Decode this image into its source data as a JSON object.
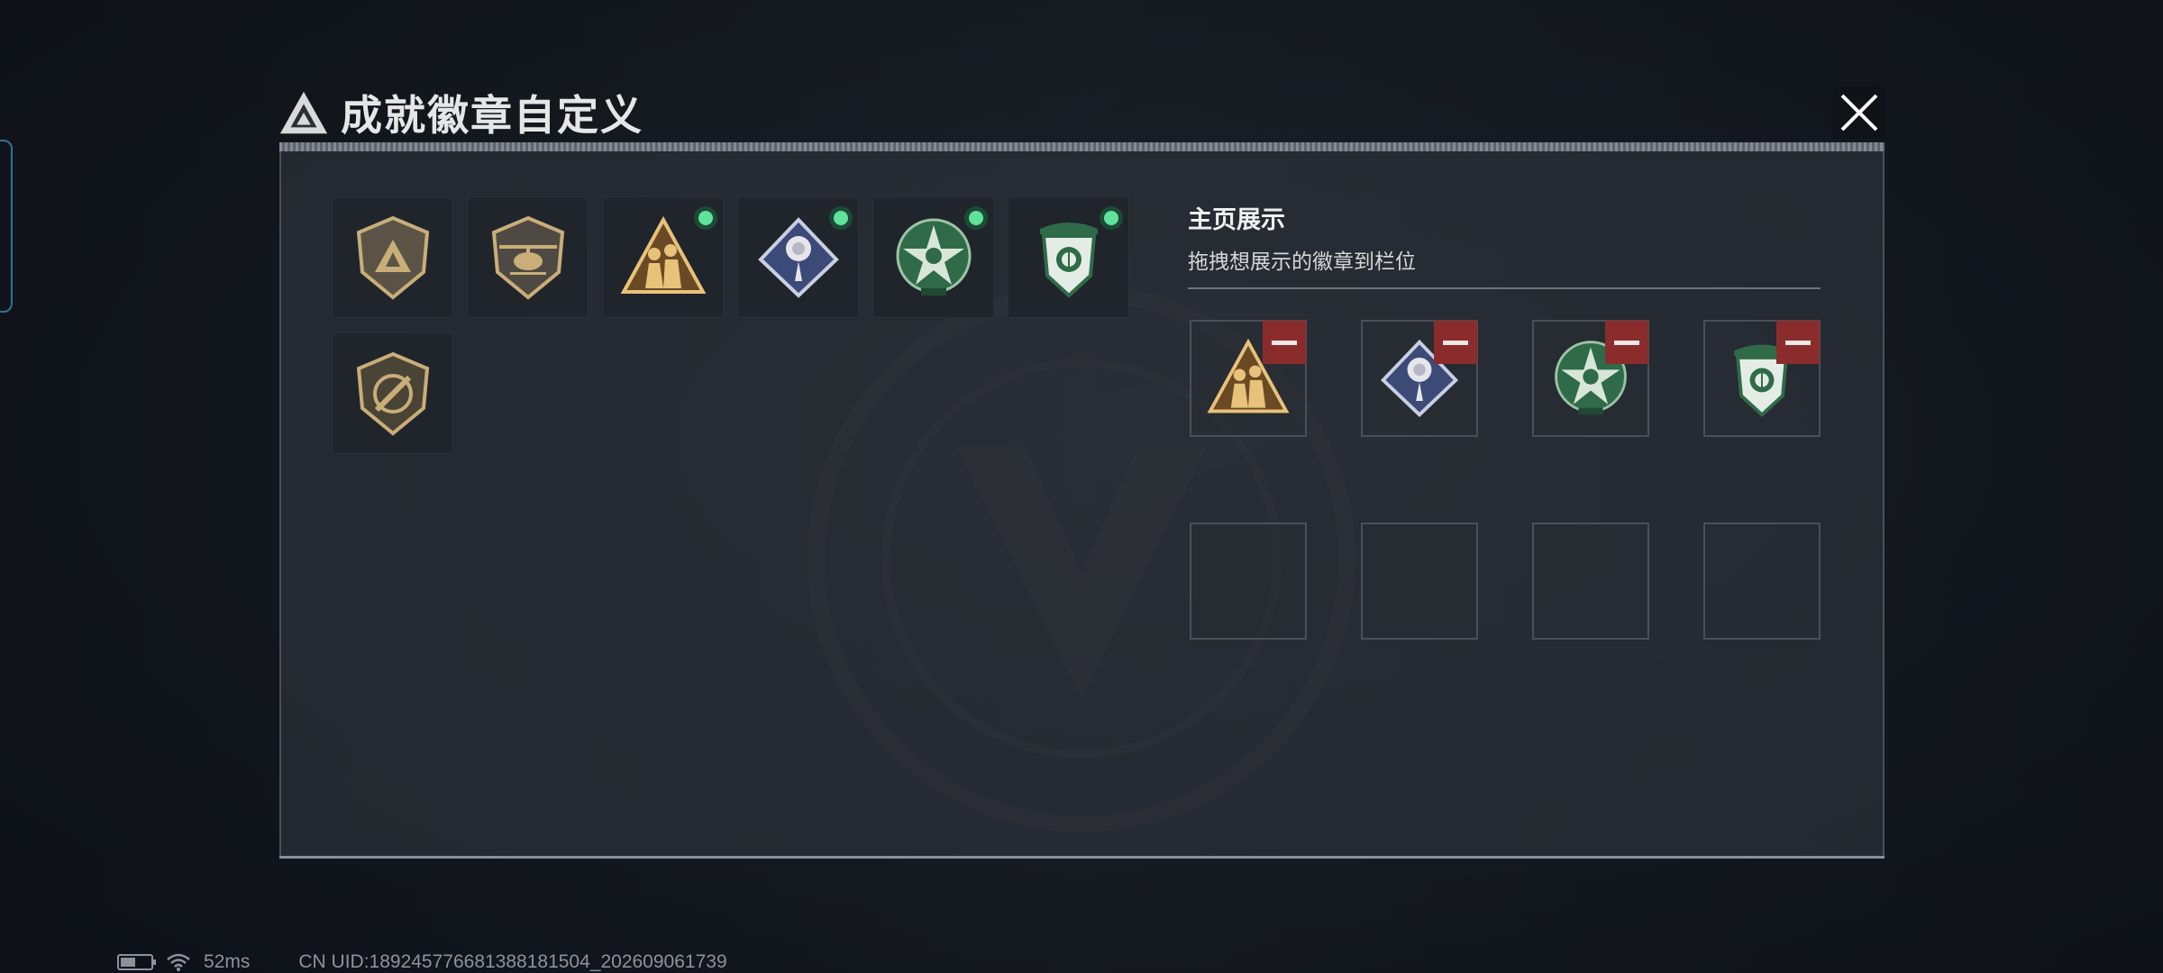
{
  "header": {
    "title": "成就徽章自定义",
    "close_icon": "close-icon"
  },
  "inventory": {
    "badges": [
      {
        "name": "triangle-shield-badge",
        "equipped": false
      },
      {
        "name": "helicopter-shield-badge",
        "equipped": false
      },
      {
        "name": "soldiers-triangle-badge",
        "equipped": true
      },
      {
        "name": "rose-diamond-badge",
        "equipped": true
      },
      {
        "name": "skull-star-badge",
        "equipped": true
      },
      {
        "name": "green-crest-badge",
        "equipped": true
      },
      {
        "name": "knife-shield-badge",
        "equipped": false
      }
    ]
  },
  "showcase": {
    "title": "主页展示",
    "subtitle": "拖拽想展示的徽章到栏位",
    "slots": [
      {
        "badge": "soldiers-triangle-badge"
      },
      {
        "badge": "rose-diamond-badge"
      },
      {
        "badge": "skull-star-badge"
      },
      {
        "badge": "green-crest-badge"
      },
      {
        "badge": null
      },
      {
        "badge": null
      },
      {
        "badge": null
      },
      {
        "badge": null
      }
    ]
  },
  "status_bar": {
    "ping": "52ms",
    "uid": "CN UID:1892457766813881815​04_202609061739"
  },
  "colors": {
    "equipped_dot": "#5fe39a",
    "remove_button": "#8b2c2c",
    "badge_gold": "#c9ae78",
    "badge_green": "#2f6b48"
  }
}
